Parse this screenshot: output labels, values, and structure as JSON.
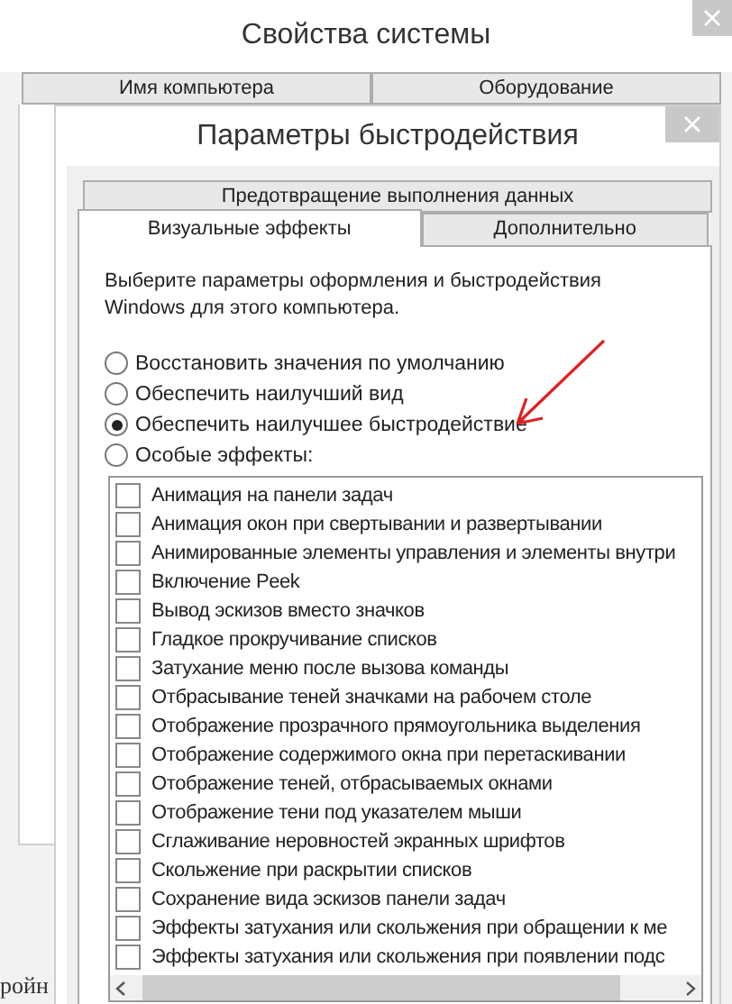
{
  "window": {
    "title": "Свойства системы",
    "tabs": [
      {
        "label": "Имя компьютера",
        "selected": false
      },
      {
        "label": "Оборудование",
        "selected": false
      }
    ],
    "text_fragment": "ройн"
  },
  "dialog": {
    "title": "Параметры быстродействия",
    "tab_rows": [
      [
        {
          "label": "Предотвращение выполнения данных",
          "selected": false
        }
      ],
      [
        {
          "label": "Визуальные эффекты",
          "selected": true
        },
        {
          "label": "Дополнительно",
          "selected": false
        }
      ]
    ],
    "description": "Выберите параметры оформления и быстродействия Windows для этого компьютера.",
    "options": [
      {
        "label": "Восстановить значения по умолчанию",
        "selected": false
      },
      {
        "label": "Обеспечить наилучший вид",
        "selected": false
      },
      {
        "label": "Обеспечить наилучшее быстродействие",
        "selected": true
      },
      {
        "label": "Особые эффекты:",
        "selected": false
      }
    ],
    "effects": [
      {
        "label": "Анимация на панели задач",
        "checked": false
      },
      {
        "label": "Анимация окон при свертывании и развертывании",
        "checked": false
      },
      {
        "label": "Анимированные элементы управления и элементы внутри",
        "checked": false
      },
      {
        "label": "Включение Peek",
        "checked": false
      },
      {
        "label": "Вывод эскизов вместо значков",
        "checked": false
      },
      {
        "label": "Гладкое прокручивание списков",
        "checked": false
      },
      {
        "label": "Затухание меню после вызова команды",
        "checked": false
      },
      {
        "label": "Отбрасывание теней значками на рабочем столе",
        "checked": false
      },
      {
        "label": "Отображение прозрачного прямоугольника выделения",
        "checked": false
      },
      {
        "label": "Отображение содержимого окна при перетаскивании",
        "checked": false
      },
      {
        "label": "Отображение теней, отбрасываемых окнами",
        "checked": false
      },
      {
        "label": "Отображение тени под указателем мыши",
        "checked": false
      },
      {
        "label": "Сглаживание неровностей экранных шрифтов",
        "checked": false
      },
      {
        "label": "Скольжение при раскрытии списков",
        "checked": false
      },
      {
        "label": "Сохранение вида эскизов панели задач",
        "checked": false
      },
      {
        "label": "Эффекты затухания или скольжения при обращении к ме",
        "checked": false
      },
      {
        "label": "Эффекты затухания или скольжения при появлении подс",
        "checked": false
      }
    ]
  }
}
